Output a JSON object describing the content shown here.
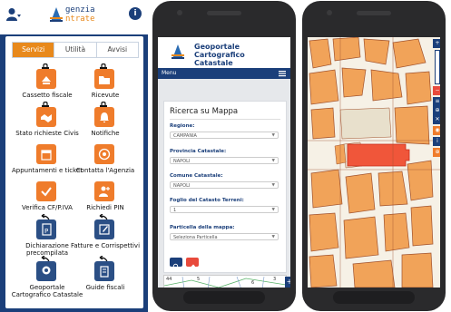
{
  "app": {
    "logo_line1": "genzia",
    "logo_line2": "ntrate",
    "info_glyph": "i",
    "tabs": [
      {
        "label": "Servizi",
        "active": true
      },
      {
        "label": "Utilità",
        "active": false
      },
      {
        "label": "Avvisi",
        "active": false
      }
    ],
    "tiles": [
      {
        "label": "Cassetto fiscale",
        "icon": "drawer-icon",
        "locked": true,
        "color": "orange"
      },
      {
        "label": "Ricevute",
        "icon": "folder-icon",
        "locked": true,
        "color": "orange"
      },
      {
        "label": "Stato richieste Civis",
        "icon": "handshake-icon",
        "locked": true,
        "color": "orange"
      },
      {
        "label": "Notifiche",
        "icon": "bell-icon",
        "locked": true,
        "color": "orange"
      },
      {
        "label": "Appuntamenti e ticket",
        "icon": "calendar-icon",
        "locked": false,
        "color": "orange"
      },
      {
        "label": "Contatta l'Agenzia",
        "icon": "at-icon",
        "locked": false,
        "color": "orange"
      },
      {
        "label": "Verifica CF/P.IVA",
        "icon": "check-icon",
        "locked": false,
        "color": "orange"
      },
      {
        "label": "Richiedi PIN",
        "icon": "add-user-icon",
        "locked": false,
        "color": "orange"
      },
      {
        "label": "Dichiarazione precompilata",
        "icon": "document-p-icon",
        "locked": false,
        "color": "blue"
      },
      {
        "label": "Fatture e Corrispettivi",
        "icon": "edit-icon",
        "locked": false,
        "color": "blue"
      },
      {
        "label": "Geoportale Cartografico Catastale",
        "icon": "map-pin-icon",
        "locked": false,
        "color": "blue"
      },
      {
        "label": "Guide fiscali",
        "icon": "book-icon",
        "locked": false,
        "color": "blue"
      }
    ]
  },
  "geoportale": {
    "title": "Geoportale Cartografico Catastale",
    "menu_label": "Menu",
    "panel_title": "Ricerca su Mappa",
    "fields": [
      {
        "label": "Regione:",
        "value": "CAMPANIA"
      },
      {
        "label": "Provincia Catastale:",
        "value": "NAPOLI"
      },
      {
        "label": "Comune Catastale:",
        "value": "NAPOLI"
      },
      {
        "label": "Foglio del Catasto Terreni:",
        "value": "1"
      },
      {
        "label": "Particella della mappa:",
        "value": "Seleziona Particella"
      }
    ],
    "map_numbers": [
      "44",
      "5",
      "6",
      "3"
    ],
    "plus_label": "+"
  },
  "map": {
    "controls": [
      "+",
      "−",
      "≡",
      "⊕",
      "✕",
      "◉",
      "i",
      "⊕"
    ]
  },
  "colors": {
    "navy": "#1b3f7a",
    "orange": "#ef7c2b",
    "parcel": "#f1a359",
    "selected": "#f0563a"
  }
}
